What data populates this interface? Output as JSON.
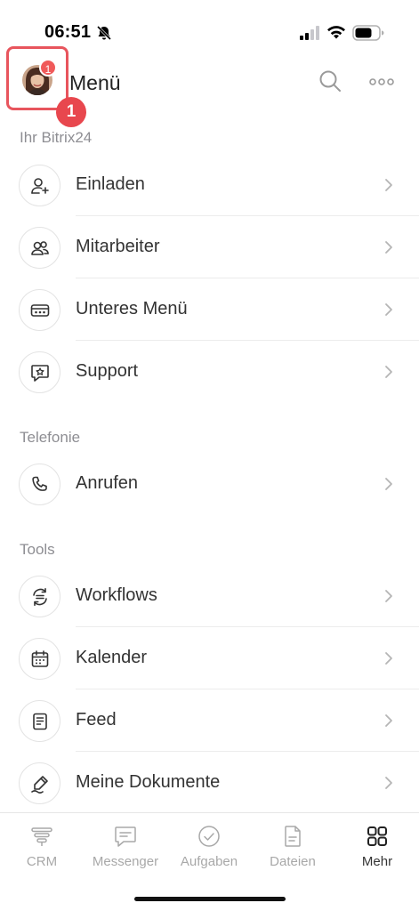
{
  "status_bar": {
    "time": "06:51"
  },
  "header": {
    "title": "Menü",
    "avatar_badge": "1",
    "callout_badge": "1"
  },
  "sections": [
    {
      "title": "Ihr Bitrix24",
      "items": [
        {
          "label": "Einladen",
          "icon": "add-user-icon"
        },
        {
          "label": "Mitarbeiter",
          "icon": "employees-icon"
        },
        {
          "label": "Unteres Menü",
          "icon": "bottom-menu-icon"
        },
        {
          "label": "Support",
          "icon": "support-chat-icon"
        }
      ]
    },
    {
      "title": "Telefonie",
      "items": [
        {
          "label": "Anrufen",
          "icon": "phone-icon"
        }
      ]
    },
    {
      "title": "Tools",
      "items": [
        {
          "label": "Workflows",
          "icon": "workflows-icon"
        },
        {
          "label": "Kalender",
          "icon": "calendar-icon"
        },
        {
          "label": "Feed",
          "icon": "feed-icon"
        },
        {
          "label": "Meine Dokumente",
          "icon": "signature-pen-icon"
        }
      ]
    }
  ],
  "tab_bar": {
    "tabs": [
      {
        "label": "CRM",
        "icon": "crm-funnel-icon",
        "active": false
      },
      {
        "label": "Messenger",
        "icon": "chat-icon",
        "active": false
      },
      {
        "label": "Aufgaben",
        "icon": "check-circle-icon",
        "active": false
      },
      {
        "label": "Dateien",
        "icon": "file-icon",
        "active": false
      },
      {
        "label": "Mehr",
        "icon": "grid-icon",
        "active": true
      }
    ]
  },
  "colors": {
    "accent_red": "#e8474e",
    "section_gray": "#8e8e93",
    "active_tab": "#333333",
    "inactive_tab": "#a8a8a8"
  }
}
